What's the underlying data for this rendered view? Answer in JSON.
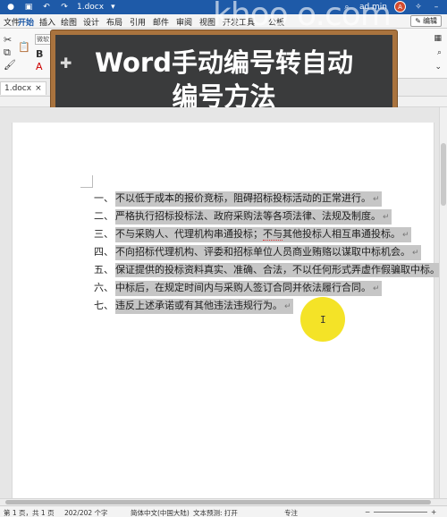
{
  "titlebar": {
    "file_name": "1.docx",
    "file_arrow": "▾",
    "search_icon": "search-icon",
    "user_name": "ad min",
    "avatar_initial": "A"
  },
  "tabs": [
    {
      "label": "文件"
    },
    {
      "label": "开始"
    },
    {
      "label": "插入"
    },
    {
      "label": "绘图"
    },
    {
      "label": "设计"
    },
    {
      "label": "布局"
    },
    {
      "label": "引用"
    },
    {
      "label": "邮件"
    },
    {
      "label": "审阅"
    },
    {
      "label": "视图"
    },
    {
      "label": "开发工具"
    },
    {
      "label": "公板"
    }
  ],
  "edit_button": {
    "label": "编辑"
  },
  "ribbon": {
    "font_box": "微软"
  },
  "doc_tab": {
    "label": "1.docx",
    "close": "×"
  },
  "board": {
    "title_line1": "Word手动编号转自动",
    "title_line2": "编号方法"
  },
  "watermark": "khoo o.com",
  "document": {
    "lines": [
      {
        "num": "一、",
        "text": "不以低于成本的报价竞标，阻碍招标投标活动的正常进行。",
        "mark": "↵"
      },
      {
        "num": "二、",
        "text": "严格执行招标投标法、政府采购法等各项法律、法规及制度。",
        "mark": "↵"
      },
      {
        "num": "三、",
        "text_before": "不与采购人、代理机构串通投标；",
        "text_squiggle": "不与",
        "text_after": "其他投标人相互串通投标。",
        "mark": "↵"
      },
      {
        "num": "四、",
        "text": "不向招标代理机构、评委和招标单位人员商业贿赂以谋取中标机会。",
        "mark": "↵"
      },
      {
        "num": "五、",
        "text": "保证提供的投标资料真实、准确、合法，不以任何形式弄虚作假骗取中标。",
        "mark": ""
      },
      {
        "num": "六、",
        "text": "中标后，在规定时间内与采购人签订合同并依法履行合同。",
        "mark": "↵"
      },
      {
        "num": "七、",
        "text": "违反上述承诺或有其他违法违规行为。",
        "mark": "↵"
      }
    ]
  },
  "statusbar": {
    "page": "第 1 页，共 1 页",
    "words": "202/202 个字",
    "language": "简体中文(中国大陆)",
    "prediction": "文本预测: 打开",
    "focus": "专注",
    "zoom_out": "−",
    "zoom_in": "+"
  }
}
